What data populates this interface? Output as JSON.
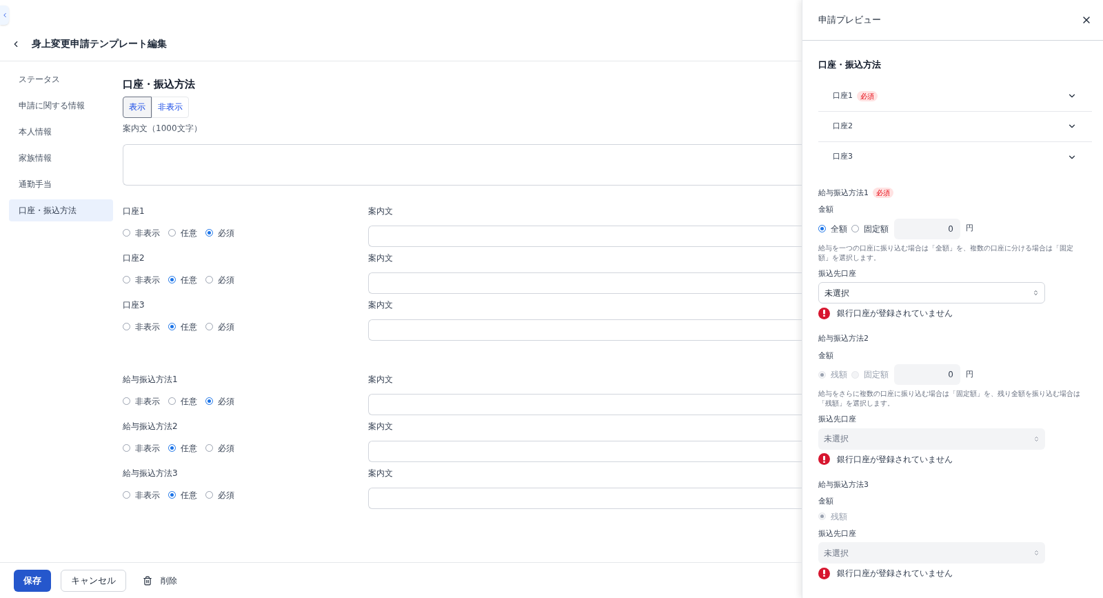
{
  "page": {
    "title": "身上変更申請テンプレート編集"
  },
  "sidebar": {
    "items": [
      {
        "label": "ステータス",
        "selected": false
      },
      {
        "label": "申請に関する情報",
        "selected": false
      },
      {
        "label": "本人情報",
        "selected": false
      },
      {
        "label": "家族情報",
        "selected": false
      },
      {
        "label": "通勤手当",
        "selected": false
      },
      {
        "label": "口座・振込方法",
        "selected": true
      }
    ]
  },
  "section": {
    "title": "口座・振込方法",
    "visibility": [
      {
        "label": "表示",
        "selected": true
      },
      {
        "label": "非表示",
        "selected": false
      }
    ],
    "guide_label": "案内文（1000文字）",
    "groups": [
      {
        "fields": [
          {
            "label": "口座1",
            "guide_label": "案内文",
            "options": [
              {
                "label": "非表示",
                "selected": false
              },
              {
                "label": "任意",
                "selected": false
              },
              {
                "label": "必須",
                "selected": true
              }
            ]
          },
          {
            "label": "口座2",
            "guide_label": "案内文",
            "options": [
              {
                "label": "非表示",
                "selected": false
              },
              {
                "label": "任意",
                "selected": true
              },
              {
                "label": "必須",
                "selected": false
              }
            ]
          },
          {
            "label": "口座3",
            "guide_label": "案内文",
            "options": [
              {
                "label": "非表示",
                "selected": false
              },
              {
                "label": "任意",
                "selected": true
              },
              {
                "label": "必須",
                "selected": false
              }
            ]
          }
        ]
      },
      {
        "fields": [
          {
            "label": "給与振込方法1",
            "guide_label": "案内文",
            "options": [
              {
                "label": "非表示",
                "selected": false
              },
              {
                "label": "任意",
                "selected": false
              },
              {
                "label": "必須",
                "selected": true
              }
            ]
          },
          {
            "label": "給与振込方法2",
            "guide_label": "案内文",
            "options": [
              {
                "label": "非表示",
                "selected": false
              },
              {
                "label": "任意",
                "selected": true
              },
              {
                "label": "必須",
                "selected": false
              }
            ]
          },
          {
            "label": "給与振込方法3",
            "guide_label": "案内文",
            "options": [
              {
                "label": "非表示",
                "selected": false
              },
              {
                "label": "任意",
                "selected": true
              },
              {
                "label": "必須",
                "selected": false
              }
            ]
          }
        ]
      }
    ]
  },
  "footer": {
    "buttons": [
      {
        "kind": "primary",
        "label": "保存"
      },
      {
        "kind": "secondary",
        "label": "キャンセル"
      },
      {
        "kind": "delete",
        "label": "削除"
      }
    ]
  },
  "preview": {
    "title": "申請プレビュー",
    "section_title": "口座・振込方法",
    "accounts": [
      {
        "label": "口座1",
        "badge": "必須"
      },
      {
        "label": "口座2"
      },
      {
        "label": "口座3"
      }
    ],
    "methods": [
      {
        "title": "給与振込方法1",
        "badge": "必須",
        "amount_label": "金額",
        "disabled": false,
        "options": [
          {
            "label": "全額",
            "selected": true
          },
          {
            "label": "固定額",
            "selected": false
          }
        ],
        "amount": {
          "value": "0",
          "unit": "円"
        },
        "help": "給与を一つの口座に振り込む場合は「全額」を、複数の口座に分ける場合は「固定額」を選択します。",
        "account_label": "振込先口座",
        "select_value": "未選択",
        "error": "銀行口座が登録されていません"
      },
      {
        "title": "給与振込方法2",
        "amount_label": "金額",
        "disabled": true,
        "options": [
          {
            "label": "残額",
            "selected": true
          },
          {
            "label": "固定額",
            "selected": false
          }
        ],
        "amount": {
          "value": "0",
          "unit": "円"
        },
        "help": "給与をさらに複数の口座に振り込む場合は「固定額」を、残り全額を振り込む場合は「残額」を選択します。",
        "account_label": "振込先口座",
        "select_value": "未選択",
        "error": "銀行口座が登録されていません"
      },
      {
        "title": "給与振込方法3",
        "amount_label": "金額",
        "disabled": true,
        "options": [
          {
            "label": "残額",
            "selected": true
          }
        ],
        "account_label": "振込先口座",
        "select_value": "未選択",
        "error": "銀行口座が登録されていません"
      }
    ]
  }
}
